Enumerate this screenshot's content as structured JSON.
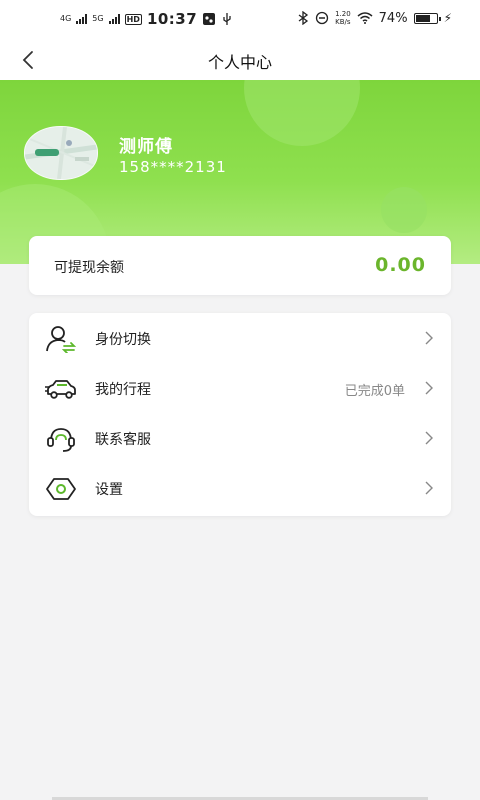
{
  "status_bar": {
    "net1": "4G",
    "net2": "5G",
    "hd": "HD",
    "time": "10:37",
    "speed_value": "1.20",
    "speed_unit": "KB/s",
    "battery_pct_text": "74%",
    "battery_level": 0.74
  },
  "header": {
    "title": "个人中心"
  },
  "profile": {
    "name": "测师傅",
    "phone": "158****2131"
  },
  "balance": {
    "label": "可提现余额",
    "value": "0.00"
  },
  "menu": {
    "items": [
      {
        "label": "身份切换",
        "extra": "",
        "icon": "switch-user-icon"
      },
      {
        "label": "我的行程",
        "extra": "已完成0单",
        "icon": "car-icon"
      },
      {
        "label": "联系客服",
        "extra": "",
        "icon": "customer-service-icon"
      },
      {
        "label": "设置",
        "extra": "",
        "icon": "settings-icon"
      }
    ]
  },
  "colors": {
    "brand_green": "#7ed53c",
    "balance_green": "#6bb52c",
    "icon_green": "#5cb82b"
  }
}
